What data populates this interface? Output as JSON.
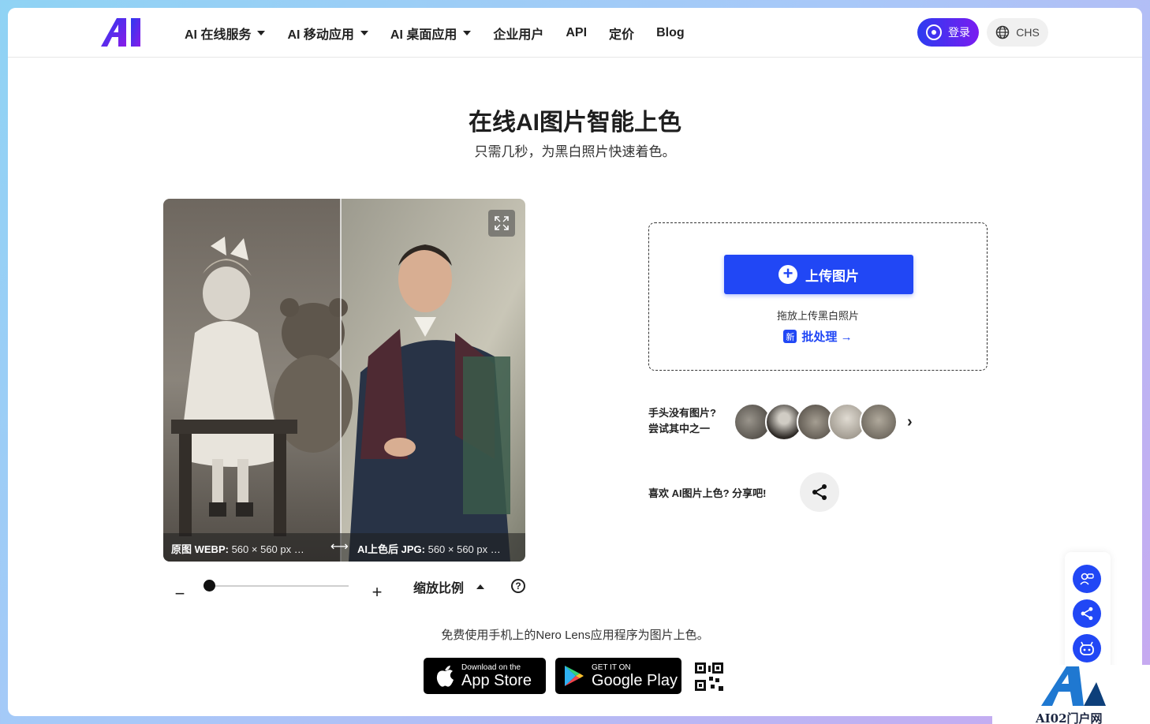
{
  "nav": {
    "items": [
      {
        "label": "AI 在线服务",
        "dropdown": true
      },
      {
        "label": "AI 移动应用",
        "dropdown": true
      },
      {
        "label": "AI 桌面应用",
        "dropdown": true
      },
      {
        "label": "企业用户",
        "dropdown": false
      },
      {
        "label": "API",
        "dropdown": false
      },
      {
        "label": "定价",
        "dropdown": false
      },
      {
        "label": "Blog",
        "dropdown": false
      }
    ],
    "login_label": "登录",
    "lang_label": "CHS"
  },
  "hero": {
    "title": "在线AI图片智能上色",
    "subtitle": "只需几秒，为黑白照片快速着色。"
  },
  "compare": {
    "left_format": "原图 WEBP:",
    "left_size": "560 × 560 px",
    "right_format": "AI上色后 JPG:",
    "right_size": "560 × 560 px",
    "ellipsis": "…",
    "divider_arrow": "⟷"
  },
  "zoom": {
    "minus": "−",
    "plus": "+",
    "label": "缩放比例",
    "help": "?",
    "level": 0
  },
  "upload": {
    "button_label": "上传图片",
    "drop_hint": "拖放上传黑白照片",
    "new_badge": "新",
    "batch_label": "批处理 →"
  },
  "samples": {
    "line1": "手头没有图片?",
    "line2": "尝试其中之一",
    "next": "›"
  },
  "share": {
    "label": "喜欢 AI图片上色? 分享吧!"
  },
  "footer": {
    "promo": "免费使用手机上的Nero Lens应用程序为图片上色。",
    "appstore_small": "Download on the",
    "appstore_big": "App Store",
    "googleplay_small": "GET IT ON",
    "googleplay_big": "Google Play"
  },
  "watermark": {
    "text": "AI02门户网"
  },
  "colors": {
    "accent": "#2147f5",
    "login_gradient_start": "#2c3cf0",
    "login_gradient_end": "#7a1cf0"
  }
}
